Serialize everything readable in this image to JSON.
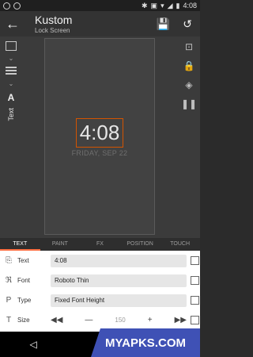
{
  "status_bar": {
    "time": "4:08"
  },
  "app_bar": {
    "title": "Kustom",
    "subtitle": "Lock Screen"
  },
  "left_tools": {
    "aa": "A",
    "text_label": "Text"
  },
  "canvas": {
    "time": "4:08",
    "date": "FRIDAY, SEP 22"
  },
  "tabs": [
    "TEXT",
    "PAINT",
    "FX",
    "POSITION",
    "TOUCH"
  ],
  "form": {
    "rows": [
      {
        "label": "Text",
        "value": "4:08"
      },
      {
        "label": "Font",
        "value": "Roboto Thin"
      },
      {
        "label": "Type",
        "value": "Fixed Font Height"
      },
      {
        "label": "Size",
        "value": "150"
      }
    ]
  },
  "watermark": "MYAPKS.COM",
  "colors": {
    "accent": "#ff7043",
    "selection": "#d35400",
    "watermark_bg": "#3f51b5"
  },
  "icons": [
    "back-arrow-icon",
    "save-icon",
    "history-icon",
    "folder-icon",
    "layers-icon",
    "lock-icon",
    "pause-icon"
  ]
}
